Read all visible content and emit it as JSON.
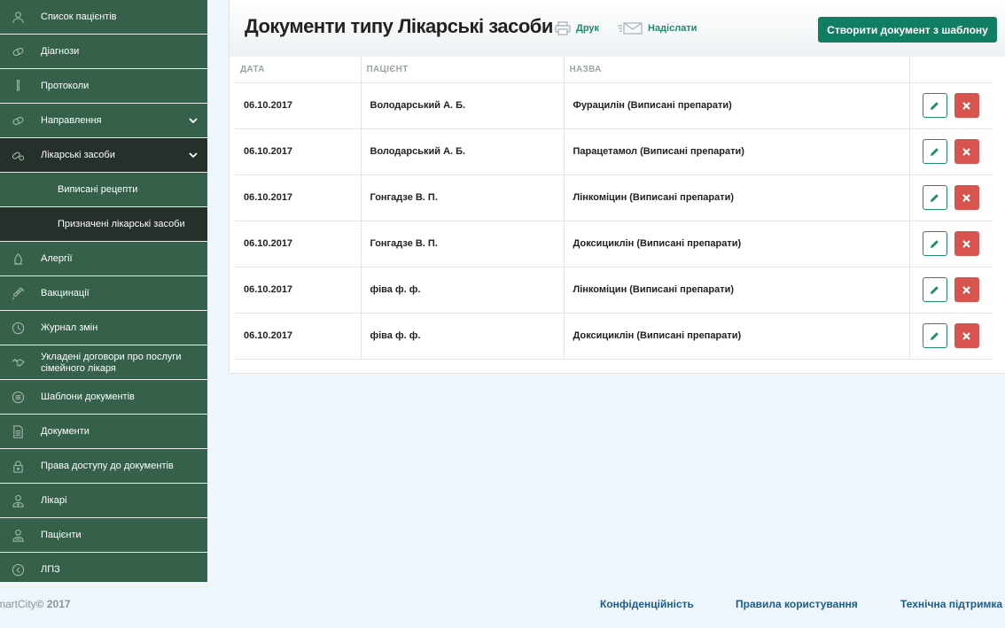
{
  "sidebar": {
    "items": [
      {
        "label": "Список пацієнтів",
        "icon": "person-icon"
      },
      {
        "label": "Діагнози",
        "icon": "pills-icon"
      },
      {
        "label": "Протоколи",
        "icon": "test-tube-icon"
      },
      {
        "label": "Направлення",
        "icon": "pills-icon"
      },
      {
        "label": "Лікарські засоби",
        "icon": "capsule-icon"
      },
      {
        "label": "Виписані рецепти"
      },
      {
        "label": "Призначені лікарські засоби"
      },
      {
        "label": "Алергії",
        "icon": "allergy-icon"
      },
      {
        "label": "Вакцинації",
        "icon": "syringe-icon"
      },
      {
        "label": "Журнал змін",
        "icon": "clock-icon"
      },
      {
        "label": "Укладені договори про послуги",
        "label2": "сімейного лікаря",
        "icon": "handshake-icon"
      },
      {
        "label": "Шаблони документів",
        "icon": "template-icon"
      },
      {
        "label": "Документи",
        "icon": "document-icon"
      },
      {
        "label": "Права доступу до документів",
        "icon": "lock-icon"
      },
      {
        "label": "Лікарі",
        "icon": "doctor-icon"
      },
      {
        "label": "Пацієнти",
        "icon": "patient-icon"
      },
      {
        "label": "ЛПЗ",
        "icon": "arrow-circle-icon"
      }
    ]
  },
  "header": {
    "title": "Документи типу Лікарські засоби",
    "print_label": "Друк",
    "send_label": "Надіслати",
    "create_label": "Створити документ з шаблону"
  },
  "table": {
    "columns": [
      "ДАТА",
      "ПАЦІЄНТ",
      "НАЗВА"
    ],
    "rows": [
      {
        "date": "06.10.2017",
        "patient": "Володарський А. Б.",
        "name": "Фурацилін (Виписані препарати)"
      },
      {
        "date": "06.10.2017",
        "patient": "Володарський А. Б.",
        "name": "Парацетамол (Виписані препарати)"
      },
      {
        "date": "06.10.2017",
        "patient": "Гонгадзе В. П.",
        "name": "Лінкоміцин (Виписані препарати)"
      },
      {
        "date": "06.10.2017",
        "patient": "Гонгадзе В. П.",
        "name": "Доксициклін (Виписані препарати)"
      },
      {
        "date": "06.10.2017",
        "patient": "фіва ф. ф.",
        "name": "Лінкоміцин (Виписані препарати)"
      },
      {
        "date": "06.10.2017",
        "patient": "фіва ф. ф.",
        "name": "Доксициклін (Виписані препарати)"
      }
    ]
  },
  "footer": {
    "brand": "martCity",
    "year": "© 2017",
    "privacy": "Конфіденційність",
    "terms": "Правила користування",
    "support": "Технічна підтримка"
  },
  "colors": {
    "sidebar": "#35604a",
    "sidebar_active": "#25302b",
    "accent": "#117e61",
    "danger": "#d9534f",
    "link": "#1b5c8f"
  }
}
